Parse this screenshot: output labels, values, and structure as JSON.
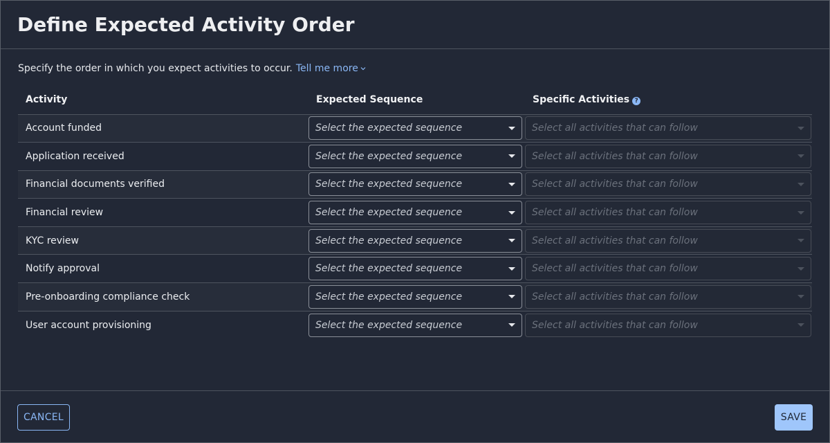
{
  "header": {
    "title": "Define Expected Activity Order"
  },
  "description": {
    "text": "Specify the order in which you expect activities to occur.",
    "link_label": "Tell me more",
    "link_icon": "chevron-down-icon"
  },
  "table": {
    "columns": [
      {
        "label": "Activity"
      },
      {
        "label": "Expected Sequence"
      },
      {
        "label": "Specific Activities",
        "icon": "help-icon"
      }
    ],
    "rows": [
      {
        "activity": "Account funded",
        "sequence_placeholder": "Select the expected sequence",
        "specific_placeholder": "Select all activities that can follow"
      },
      {
        "activity": "Application received",
        "sequence_placeholder": "Select the expected sequence",
        "specific_placeholder": "Select all activities that can follow"
      },
      {
        "activity": "Financial documents verified",
        "sequence_placeholder": "Select the expected sequence",
        "specific_placeholder": "Select all activities that can follow"
      },
      {
        "activity": "Financial review",
        "sequence_placeholder": "Select the expected sequence",
        "specific_placeholder": "Select all activities that can follow"
      },
      {
        "activity": "KYC review",
        "sequence_placeholder": "Select the expected sequence",
        "specific_placeholder": "Select all activities that can follow"
      },
      {
        "activity": "Notify approval",
        "sequence_placeholder": "Select the expected sequence",
        "specific_placeholder": "Select all activities that can follow"
      },
      {
        "activity": "Pre-onboarding compliance check",
        "sequence_placeholder": "Select the expected sequence",
        "specific_placeholder": "Select all activities that can follow"
      },
      {
        "activity": "User account provisioning",
        "sequence_placeholder": "Select the expected sequence",
        "specific_placeholder": "Select all activities that can follow"
      }
    ]
  },
  "footer": {
    "cancel_label": "CANCEL",
    "save_label": "SAVE"
  },
  "colors": {
    "background": "#222836",
    "accent": "#8ab7f5",
    "primary_button": "#9fc6fb"
  }
}
